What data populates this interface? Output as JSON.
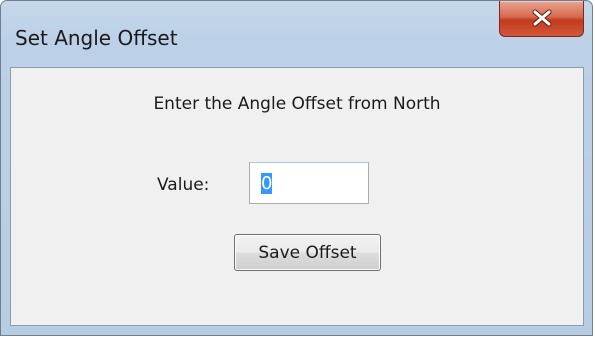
{
  "window": {
    "title": "Set Angle Offset",
    "close_icon": "close-x-icon",
    "close_button_color": "#c9452a"
  },
  "dialog": {
    "prompt": "Enter the Angle Offset from North",
    "value_label": "Value:",
    "value": "0",
    "save_button_label": "Save Offset"
  }
}
